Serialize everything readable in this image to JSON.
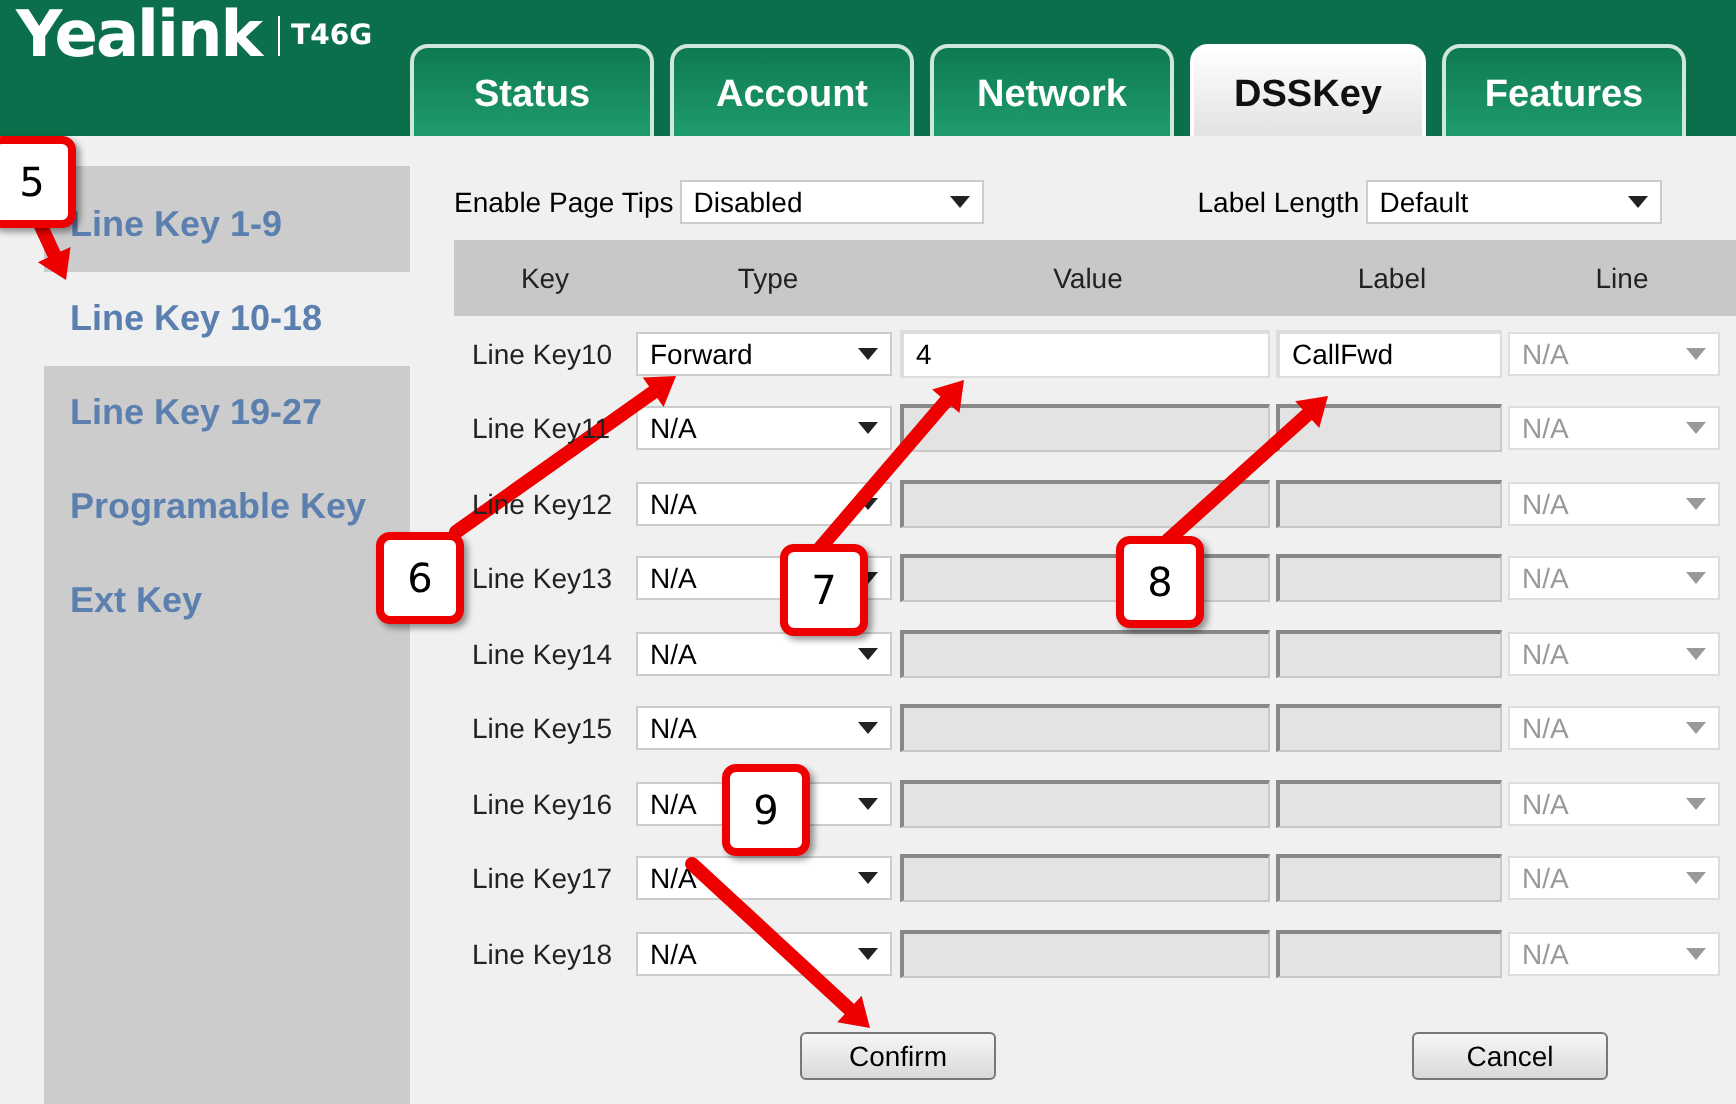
{
  "header": {
    "logo": "Yealink",
    "model": "T46G"
  },
  "tabs": [
    {
      "label": "Status",
      "selected": false
    },
    {
      "label": "Account",
      "selected": false
    },
    {
      "label": "Network",
      "selected": false
    },
    {
      "label": "DSSKey",
      "selected": true
    },
    {
      "label": "Features",
      "selected": false
    }
  ],
  "sidebar": {
    "items": [
      {
        "label": "Line Key 1-9",
        "selected": false
      },
      {
        "label": "Line Key 10-18",
        "selected": true
      },
      {
        "label": "Line Key 19-27",
        "selected": false
      },
      {
        "label": "Programable Key",
        "selected": false
      },
      {
        "label": "Ext Key",
        "selected": false
      }
    ]
  },
  "settings": [
    {
      "label": "Enable Page Tips",
      "value": "Disabled"
    },
    {
      "label": "Label Length",
      "value": "Default"
    }
  ],
  "table": {
    "columns": [
      "Key",
      "Type",
      "Value",
      "Label",
      "Line"
    ],
    "rows": [
      {
        "key": "Line Key10",
        "type": "Forward",
        "value": "4",
        "label": "CallFwd",
        "line": "N/A",
        "disabled": false
      },
      {
        "key": "Line Key11",
        "type": "N/A",
        "line": "N/A",
        "disabled": true
      },
      {
        "key": "Line Key12",
        "type": "N/A",
        "line": "N/A",
        "disabled": true
      },
      {
        "key": "Line Key13",
        "type": "N/A",
        "line": "N/A",
        "disabled": true
      },
      {
        "key": "Line Key14",
        "type": "N/A",
        "line": "N/A",
        "disabled": true
      },
      {
        "key": "Line Key15",
        "type": "N/A",
        "line": "N/A",
        "disabled": true
      },
      {
        "key": "Line Key16",
        "type": "N/A",
        "line": "N/A",
        "disabled": true
      },
      {
        "key": "Line Key17",
        "type": "N/A",
        "line": "N/A",
        "disabled": true
      },
      {
        "key": "Line Key18",
        "type": "N/A",
        "line": "N/A",
        "disabled": true
      }
    ]
  },
  "buttons": [
    "Confirm",
    "Cancel"
  ],
  "callouts": [
    {
      "number": "5"
    },
    {
      "number": "6"
    },
    {
      "number": "7"
    },
    {
      "number": "8"
    },
    {
      "number": "9"
    }
  ]
}
